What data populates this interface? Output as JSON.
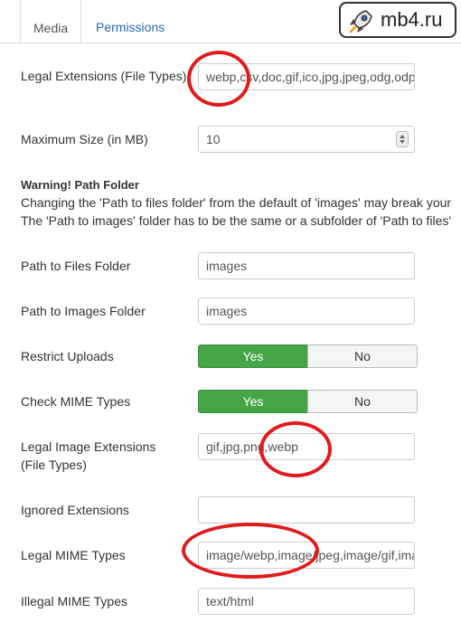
{
  "tabs": [
    {
      "label": "Media",
      "active": true
    },
    {
      "label": "Permissions",
      "active": false
    }
  ],
  "watermark": {
    "text": "mb4.ru",
    "icon": "rocket-icon"
  },
  "fields": {
    "legal_extensions": {
      "label": "Legal Extensions (File Types)",
      "value": "webp,csv,doc,gif,ico,jpg,jpeg,odg,odp"
    },
    "max_size": {
      "label": "Maximum Size (in MB)",
      "value": "10"
    },
    "warning": {
      "title": "Warning! Path Folder",
      "line1": "Changing the 'Path to files folder' from the default of 'images' may break your",
      "line2": "The 'Path to images' folder has to be the same or a subfolder of 'Path to files'"
    },
    "path_files": {
      "label": "Path to Files Folder",
      "value": "images"
    },
    "path_images": {
      "label": "Path to Images Folder",
      "value": "images"
    },
    "restrict_uploads": {
      "label": "Restrict Uploads",
      "yes": "Yes",
      "no": "No",
      "selected": "Yes"
    },
    "check_mime": {
      "label": "Check MIME Types",
      "yes": "Yes",
      "no": "No",
      "selected": "Yes"
    },
    "legal_image_ext": {
      "label": "Legal Image Extensions (File Types)",
      "value": "gif,jpg,png,webp"
    },
    "ignored_ext": {
      "label": "Ignored Extensions",
      "value": ""
    },
    "legal_mime": {
      "label": "Legal MIME Types",
      "value": "image/webp,image/jpeg,image/gif,image/png"
    },
    "illegal_mime": {
      "label": "Illegal MIME Types",
      "value": "text/html"
    }
  },
  "colors": {
    "accent_green": "#46a546",
    "tab_link": "#2a69b8",
    "annotation_red": "#e01b1b"
  }
}
